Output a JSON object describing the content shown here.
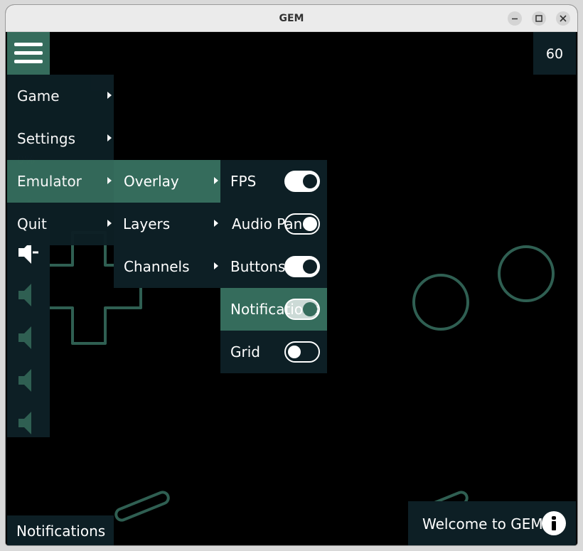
{
  "window": {
    "title": "GEM"
  },
  "fps_counter": "60",
  "main_menu": {
    "items": [
      {
        "label": "Game",
        "has_submenu": true
      },
      {
        "label": "Settings",
        "has_submenu": true
      },
      {
        "label": "Emulator",
        "has_submenu": true,
        "active": true
      },
      {
        "label": "Quit",
        "has_submenu": true
      }
    ]
  },
  "emulator_menu": {
    "items": [
      {
        "label": "Overlay",
        "has_submenu": true,
        "active": true
      },
      {
        "label": "Layers",
        "has_submenu": true
      },
      {
        "label": "Channels",
        "has_submenu": true
      }
    ]
  },
  "overlay_menu": {
    "items": [
      {
        "label": "FPS",
        "toggle": "on"
      },
      {
        "label": "Audio Panel",
        "toggle": "on"
      },
      {
        "label": "Buttons",
        "toggle": "on"
      },
      {
        "label": "Notifications",
        "toggle": "on",
        "active": true
      },
      {
        "label": "Grid",
        "toggle": "off"
      }
    ]
  },
  "volume_hint": "0%",
  "notifications_button": "Notifications",
  "toast": {
    "message": "Welcome to GEM",
    "icon": "info-icon"
  },
  "colors": {
    "panel": "#0d1f25",
    "accent": "#356c5c",
    "outline": "#2f5f52",
    "background": "#000000"
  }
}
